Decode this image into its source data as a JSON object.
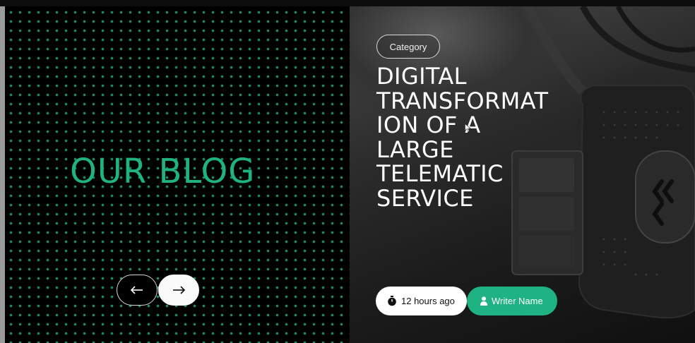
{
  "blog": {
    "heading": "OUR BLOG",
    "prev_icon": "arrow-left-icon",
    "next_icon": "arrow-right-icon"
  },
  "article": {
    "category": "Category",
    "title_lines": [
      "DIGITAL",
      "TRANSFORMAT",
      "ION  OF  A",
      "LARGE",
      "TELEMATIC",
      "SERVICE"
    ],
    "time_ago": "12 hours ago",
    "time_icon": "stopwatch-icon",
    "writer": "Writer Name",
    "writer_icon": "person-icon",
    "image": "telematics-device-photo"
  },
  "colors": {
    "accent": "#1fb283",
    "dot": "#1e8a63",
    "background": "#000000",
    "pill_light": "#ffffff"
  }
}
